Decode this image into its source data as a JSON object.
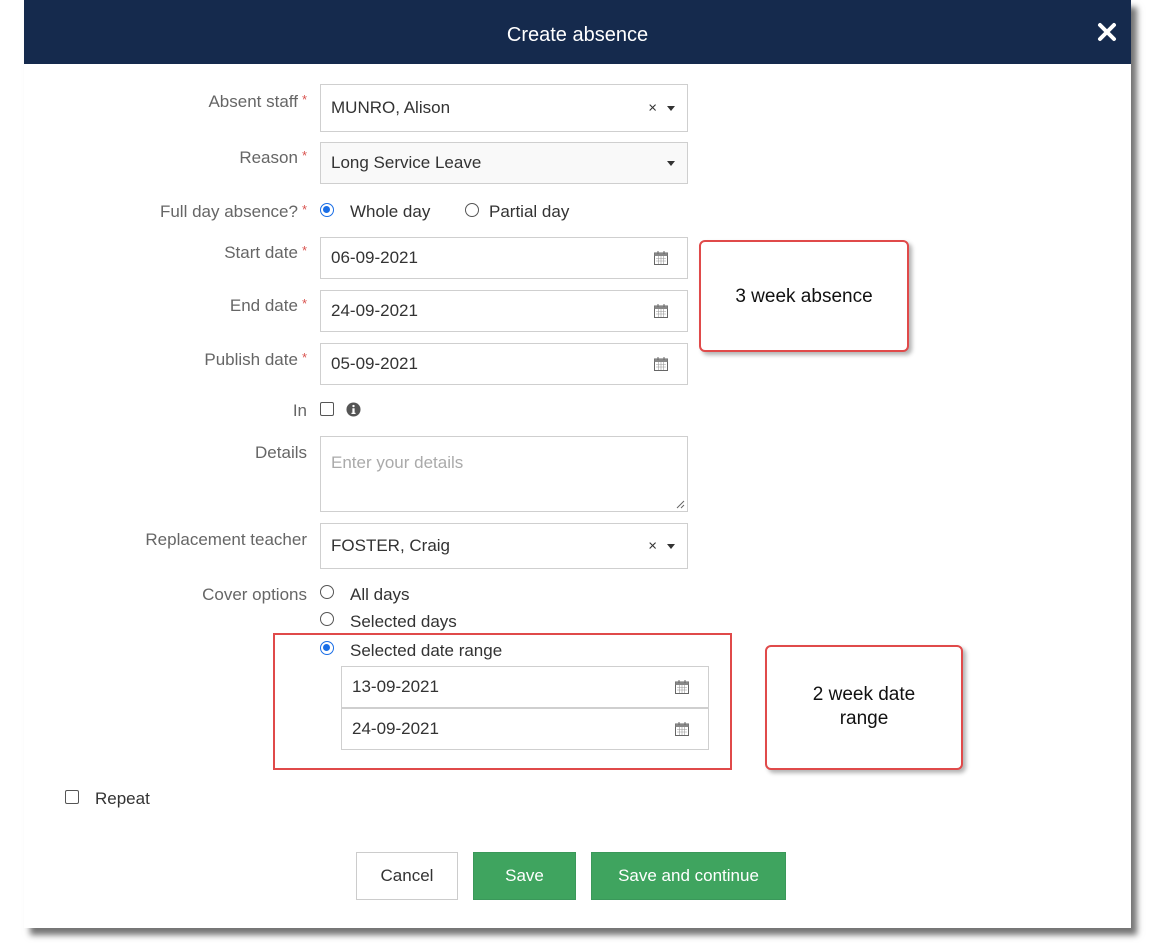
{
  "dialog": {
    "title": "Create absence",
    "close_icon": "close-icon"
  },
  "colors": {
    "header": "#152a4d",
    "required": "#d9534f",
    "primary": "#3fa45f",
    "radio": "#1a6ee6",
    "annotation": "#e04a4a"
  },
  "form": {
    "absent_staff": {
      "label": "Absent staff",
      "value": "MUNRO, Alison",
      "clear": "×"
    },
    "reason": {
      "label": "Reason",
      "value": "Long Service Leave"
    },
    "full_day": {
      "label": "Full day absence?",
      "options": [
        "Whole day",
        "Partial day"
      ],
      "selected": "Whole day"
    },
    "start_date": {
      "label": "Start date",
      "value": "06-09-2021"
    },
    "end_date": {
      "label": "End date",
      "value": "24-09-2021"
    },
    "publish_date": {
      "label": "Publish date",
      "value": "05-09-2021"
    },
    "in": {
      "label": "In",
      "checked": false
    },
    "details": {
      "label": "Details",
      "placeholder": "Enter your details"
    },
    "replacement": {
      "label": "Replacement teacher",
      "value": "FOSTER, Craig",
      "clear": "×"
    },
    "cover": {
      "label": "Cover options",
      "options": [
        "All days",
        "Selected days",
        "Selected date range"
      ],
      "selected": "Selected date range",
      "range_start": "13-09-2021",
      "range_end": "24-09-2021"
    },
    "repeat": {
      "label": "Repeat",
      "checked": false
    },
    "required_mark": "*"
  },
  "annotations": {
    "absence": "3 week absence",
    "range_line1": "2 week date",
    "range_line2": "range"
  },
  "buttons": {
    "cancel": "Cancel",
    "save": "Save",
    "save_continue": "Save and continue"
  }
}
